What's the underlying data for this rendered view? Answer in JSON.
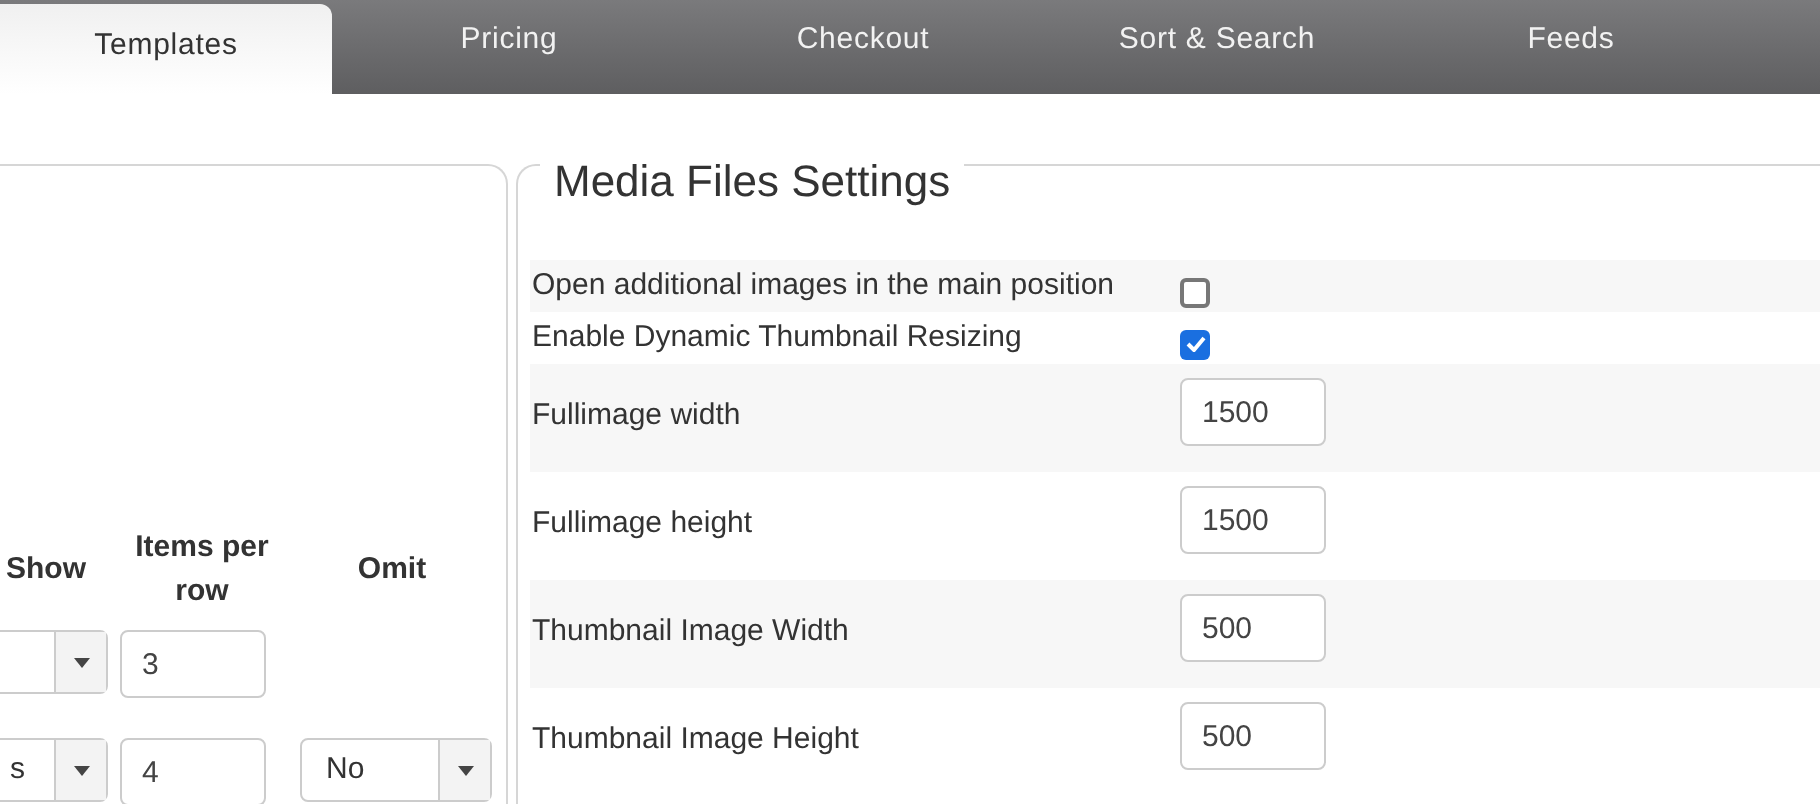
{
  "tabs": [
    {
      "label": "Templates",
      "selected": true
    },
    {
      "label": "Pricing",
      "selected": false
    },
    {
      "label": "Checkout",
      "selected": false
    },
    {
      "label": "Sort & Search",
      "selected": false
    },
    {
      "label": "Feeds",
      "selected": false
    }
  ],
  "left_table": {
    "columns": [
      "Show",
      "Items per row",
      "Omit"
    ],
    "rows": [
      {
        "show": "",
        "items_per_row": "3"
      },
      {
        "show": "s",
        "items_per_row": "4",
        "omit": "No"
      }
    ]
  },
  "media_settings": {
    "title": "Media Files Settings",
    "rows": [
      {
        "kind": "checkbox",
        "label": "Open additional images in the main position",
        "checked": false
      },
      {
        "kind": "checkbox",
        "label": "Enable Dynamic Thumbnail Resizing",
        "checked": true
      },
      {
        "kind": "input",
        "label": "Fullimage width",
        "value": "1500"
      },
      {
        "kind": "input",
        "label": "Fullimage height",
        "value": "1500"
      },
      {
        "kind": "input",
        "label": "Thumbnail Image Width",
        "value": "500"
      },
      {
        "kind": "input",
        "label": "Thumbnail Image Height",
        "value": "500"
      }
    ]
  }
}
